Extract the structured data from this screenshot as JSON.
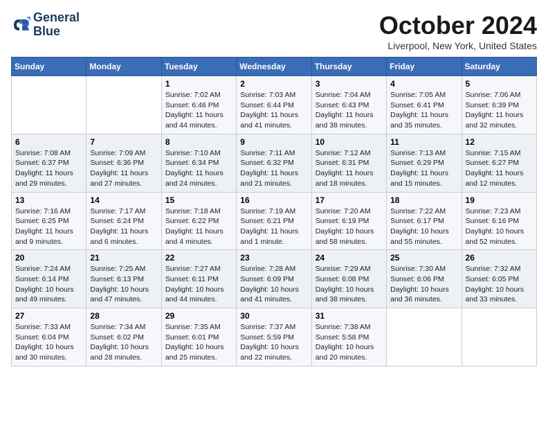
{
  "logo": {
    "line1": "General",
    "line2": "Blue"
  },
  "title": "October 2024",
  "location": "Liverpool, New York, United States",
  "weekdays": [
    "Sunday",
    "Monday",
    "Tuesday",
    "Wednesday",
    "Thursday",
    "Friday",
    "Saturday"
  ],
  "weeks": [
    [
      {
        "day": "",
        "detail": ""
      },
      {
        "day": "",
        "detail": ""
      },
      {
        "day": "1",
        "detail": "Sunrise: 7:02 AM\nSunset: 6:46 PM\nDaylight: 11 hours and 44 minutes."
      },
      {
        "day": "2",
        "detail": "Sunrise: 7:03 AM\nSunset: 6:44 PM\nDaylight: 11 hours and 41 minutes."
      },
      {
        "day": "3",
        "detail": "Sunrise: 7:04 AM\nSunset: 6:43 PM\nDaylight: 11 hours and 38 minutes."
      },
      {
        "day": "4",
        "detail": "Sunrise: 7:05 AM\nSunset: 6:41 PM\nDaylight: 11 hours and 35 minutes."
      },
      {
        "day": "5",
        "detail": "Sunrise: 7:06 AM\nSunset: 6:39 PM\nDaylight: 11 hours and 32 minutes."
      }
    ],
    [
      {
        "day": "6",
        "detail": "Sunrise: 7:08 AM\nSunset: 6:37 PM\nDaylight: 11 hours and 29 minutes."
      },
      {
        "day": "7",
        "detail": "Sunrise: 7:09 AM\nSunset: 6:36 PM\nDaylight: 11 hours and 27 minutes."
      },
      {
        "day": "8",
        "detail": "Sunrise: 7:10 AM\nSunset: 6:34 PM\nDaylight: 11 hours and 24 minutes."
      },
      {
        "day": "9",
        "detail": "Sunrise: 7:11 AM\nSunset: 6:32 PM\nDaylight: 11 hours and 21 minutes."
      },
      {
        "day": "10",
        "detail": "Sunrise: 7:12 AM\nSunset: 6:31 PM\nDaylight: 11 hours and 18 minutes."
      },
      {
        "day": "11",
        "detail": "Sunrise: 7:13 AM\nSunset: 6:29 PM\nDaylight: 11 hours and 15 minutes."
      },
      {
        "day": "12",
        "detail": "Sunrise: 7:15 AM\nSunset: 6:27 PM\nDaylight: 11 hours and 12 minutes."
      }
    ],
    [
      {
        "day": "13",
        "detail": "Sunrise: 7:16 AM\nSunset: 6:25 PM\nDaylight: 11 hours and 9 minutes."
      },
      {
        "day": "14",
        "detail": "Sunrise: 7:17 AM\nSunset: 6:24 PM\nDaylight: 11 hours and 6 minutes."
      },
      {
        "day": "15",
        "detail": "Sunrise: 7:18 AM\nSunset: 6:22 PM\nDaylight: 11 hours and 4 minutes."
      },
      {
        "day": "16",
        "detail": "Sunrise: 7:19 AM\nSunset: 6:21 PM\nDaylight: 11 hours and 1 minute."
      },
      {
        "day": "17",
        "detail": "Sunrise: 7:20 AM\nSunset: 6:19 PM\nDaylight: 10 hours and 58 minutes."
      },
      {
        "day": "18",
        "detail": "Sunrise: 7:22 AM\nSunset: 6:17 PM\nDaylight: 10 hours and 55 minutes."
      },
      {
        "day": "19",
        "detail": "Sunrise: 7:23 AM\nSunset: 6:16 PM\nDaylight: 10 hours and 52 minutes."
      }
    ],
    [
      {
        "day": "20",
        "detail": "Sunrise: 7:24 AM\nSunset: 6:14 PM\nDaylight: 10 hours and 49 minutes."
      },
      {
        "day": "21",
        "detail": "Sunrise: 7:25 AM\nSunset: 6:13 PM\nDaylight: 10 hours and 47 minutes."
      },
      {
        "day": "22",
        "detail": "Sunrise: 7:27 AM\nSunset: 6:11 PM\nDaylight: 10 hours and 44 minutes."
      },
      {
        "day": "23",
        "detail": "Sunrise: 7:28 AM\nSunset: 6:09 PM\nDaylight: 10 hours and 41 minutes."
      },
      {
        "day": "24",
        "detail": "Sunrise: 7:29 AM\nSunset: 6:08 PM\nDaylight: 10 hours and 38 minutes."
      },
      {
        "day": "25",
        "detail": "Sunrise: 7:30 AM\nSunset: 6:06 PM\nDaylight: 10 hours and 36 minutes."
      },
      {
        "day": "26",
        "detail": "Sunrise: 7:32 AM\nSunset: 6:05 PM\nDaylight: 10 hours and 33 minutes."
      }
    ],
    [
      {
        "day": "27",
        "detail": "Sunrise: 7:33 AM\nSunset: 6:04 PM\nDaylight: 10 hours and 30 minutes."
      },
      {
        "day": "28",
        "detail": "Sunrise: 7:34 AM\nSunset: 6:02 PM\nDaylight: 10 hours and 28 minutes."
      },
      {
        "day": "29",
        "detail": "Sunrise: 7:35 AM\nSunset: 6:01 PM\nDaylight: 10 hours and 25 minutes."
      },
      {
        "day": "30",
        "detail": "Sunrise: 7:37 AM\nSunset: 5:59 PM\nDaylight: 10 hours and 22 minutes."
      },
      {
        "day": "31",
        "detail": "Sunrise: 7:38 AM\nSunset: 5:58 PM\nDaylight: 10 hours and 20 minutes."
      },
      {
        "day": "",
        "detail": ""
      },
      {
        "day": "",
        "detail": ""
      }
    ]
  ]
}
